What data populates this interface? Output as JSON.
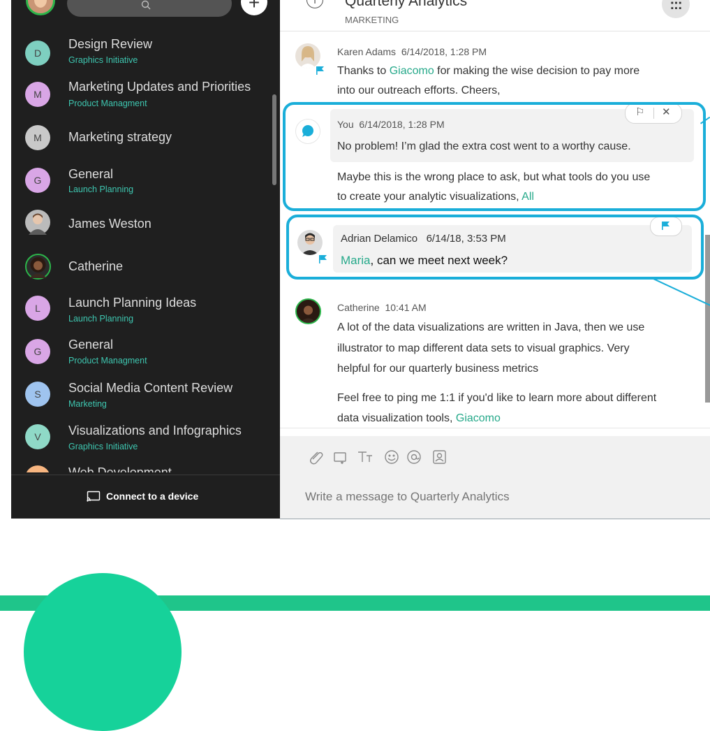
{
  "sidebar": {
    "search_icon": "search-icon",
    "add_label": "+",
    "spaces": [
      {
        "initial": "D",
        "name": "Design Review",
        "sub": "Graphics Initiative",
        "color": "#7ecfc0"
      },
      {
        "initial": "M",
        "name": "Marketing Updates and Priorities",
        "sub": "Product Managment",
        "color": "#d9a6e6"
      },
      {
        "initial": "M",
        "name": "Marketing strategy",
        "sub": "",
        "color": "#c9c9c9"
      },
      {
        "initial": "G",
        "name": "General",
        "sub": "Launch Planning",
        "color": "#d9a6e6"
      },
      {
        "initial": "",
        "name": "James Weston",
        "sub": "",
        "color": "#bbbbbb"
      },
      {
        "initial": "",
        "name": "Catherine",
        "sub": "",
        "color": "#2b2b2b"
      },
      {
        "initial": "L",
        "name": "Launch Planning Ideas",
        "sub": "Launch Planning",
        "color": "#d9a6e6"
      },
      {
        "initial": "G",
        "name": "General",
        "sub": "Product Managment",
        "color": "#d9a6e6"
      },
      {
        "initial": "S",
        "name": "Social Media Content Review",
        "sub": "Marketing",
        "color": "#9fc4ef"
      },
      {
        "initial": "V",
        "name": "Visualizations and Infographics",
        "sub": "Graphics Initiative",
        "color": "#8fd9c7"
      },
      {
        "initial": "",
        "name": "Web Development",
        "sub": "",
        "color": "#f7b580"
      }
    ],
    "connect_label": "Connect to a device"
  },
  "room": {
    "title": "Quarterly Analytics",
    "subtitle": "MARKETING",
    "more_label": ":::"
  },
  "messages": [
    {
      "author": "Karen Adams",
      "time": "6/14/2018, 1:28 PM",
      "line1_pre": "Thanks to ",
      "line1_mention": "Giacomo",
      "line1_post": " for making the wise decision to pay more",
      "line2": "into our outreach efforts. Cheers,"
    },
    {
      "author": "You",
      "time": "6/14/2018, 1:28 PM",
      "line1": "No problem! I’m glad the extra cost went to a worthy cause.",
      "line2": "Maybe this is the wrong place to ask, but what tools do you use",
      "line3_pre": "to create your analytic visualizations, ",
      "line3_mention": "All"
    },
    {
      "author": "Adrian Delamico",
      "time": "6/14/18, 3:53 PM",
      "mention": "Maria",
      "text": ", can we meet next week?"
    },
    {
      "author": "Catherine",
      "time": "10:41 AM",
      "line1": "A lot of the data visualizations are written in Java, then we use",
      "line2": "illustrator to map different data sets to visual graphics. Very",
      "line3": "helpful for our quarterly business metrics",
      "line4": "Feel free to ping me 1:1 if you'd like to learn more about different",
      "line5_pre": "data visualization tools, ",
      "line5_mention": "Giacomo"
    }
  ],
  "compose": {
    "placeholder": "Write a message to Quarterly Analytics",
    "tools": [
      "paperclip-icon",
      "whiteboard-icon",
      "text-format-icon",
      "emoji-icon",
      "mention-icon",
      "contact-icon"
    ]
  },
  "colors": {
    "accent": "#1aaed9",
    "mention": "#26a98a",
    "presence": "#2cb54a",
    "band": "#1fc58a"
  }
}
